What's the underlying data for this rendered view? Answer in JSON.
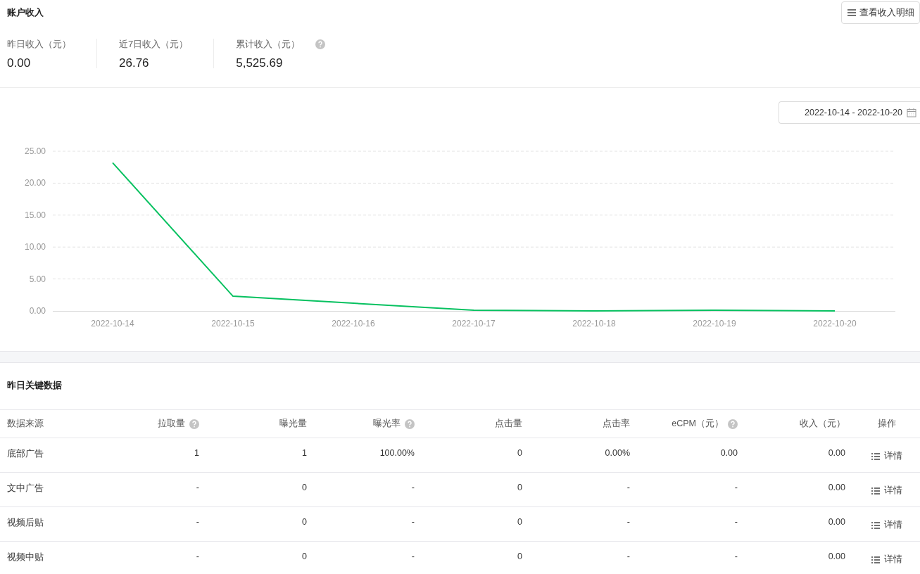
{
  "header": {
    "title": "账户收入",
    "detail_button": "查看收入明细",
    "stats": [
      {
        "label": "昨日收入（元）",
        "value": "0.00",
        "help": false
      },
      {
        "label": "近7日收入（元）",
        "value": "26.76",
        "help": false
      },
      {
        "label": "累计收入（元）",
        "value": "5,525.69",
        "help": true
      }
    ]
  },
  "chart": {
    "date_range": "2022-10-14 - 2022-10-20",
    "chart_data": {
      "type": "line",
      "categories": [
        "2022-10-14",
        "2022-10-15",
        "2022-10-16",
        "2022-10-17",
        "2022-10-18",
        "2022-10-19",
        "2022-10-20"
      ],
      "series": [
        {
          "color": "#07c160",
          "values": [
            23.2,
            2.3,
            1.2,
            0.1,
            0.0,
            0.1,
            0.0
          ]
        }
      ],
      "grid": true,
      "ylim": [
        0,
        25
      ],
      "yticks": [
        {
          "value": 0,
          "label": "0.00"
        },
        {
          "value": 5,
          "label": "5.00"
        },
        {
          "value": 10,
          "label": "10.00"
        },
        {
          "value": 15,
          "label": "15.00"
        },
        {
          "value": 20,
          "label": "20.00"
        },
        {
          "value": 25,
          "label": "25.00"
        }
      ]
    }
  },
  "table": {
    "title": "昨日关键数据",
    "columns": [
      {
        "label": "数据来源",
        "help": false
      },
      {
        "label": "拉取量",
        "help": true
      },
      {
        "label": "曝光量",
        "help": false
      },
      {
        "label": "曝光率",
        "help": true
      },
      {
        "label": "点击量",
        "help": false
      },
      {
        "label": "点击率",
        "help": false
      },
      {
        "label": "eCPM（元）",
        "help": true
      },
      {
        "label": "收入（元）",
        "help": false
      },
      {
        "label": "操作",
        "help": false
      }
    ],
    "rows": [
      {
        "cells": [
          "底部广告",
          "1",
          "1",
          "100.00%",
          "0",
          "0.00%",
          "0.00",
          "0.00"
        ],
        "action": "详情"
      },
      {
        "cells": [
          "文中广告",
          "-",
          "0",
          "-",
          "0",
          "-",
          "-",
          "0.00"
        ],
        "action": "详情"
      },
      {
        "cells": [
          "视频后贴",
          "-",
          "0",
          "-",
          "0",
          "-",
          "-",
          "0.00"
        ],
        "action": "详情"
      },
      {
        "cells": [
          "视频中贴",
          "-",
          "0",
          "-",
          "0",
          "-",
          "-",
          "0.00"
        ],
        "action": "详情"
      }
    ]
  }
}
